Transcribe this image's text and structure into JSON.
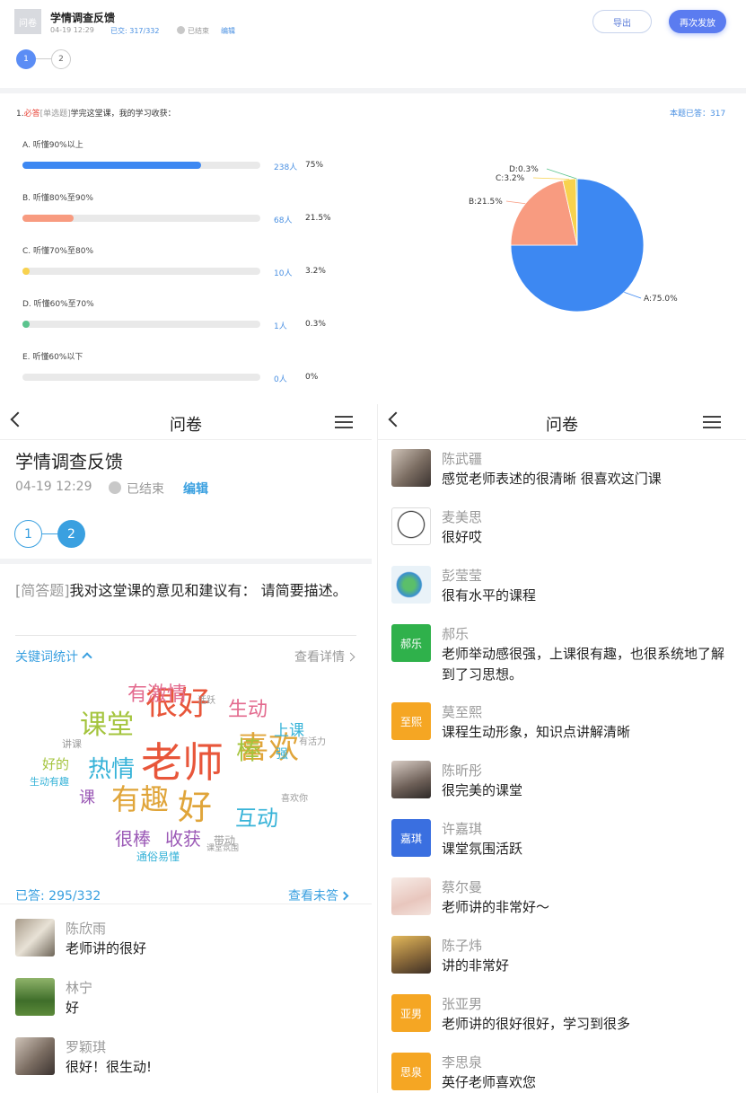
{
  "top": {
    "thumb_text": "问卷",
    "title": "学情调查反馈",
    "date": "04-19 12:29",
    "submitted": "已交: 317/332",
    "status": "已结束",
    "edit": "编辑",
    "export_btn": "导出",
    "resend_btn": "再次发放",
    "pages": [
      "1",
      "2"
    ],
    "question": {
      "num": "1.",
      "required": "必答",
      "type": "[单选题]",
      "text": "学完这堂课，我的学习收获：",
      "answered": "本题已答：317"
    },
    "options": [
      {
        "label": "A. 听懂90%以上",
        "count": "238人",
        "pct": "75%",
        "ratio": 0.75,
        "color": "#3d88f2"
      },
      {
        "label": "B. 听懂80%至90%",
        "count": "68人",
        "pct": "21.5%",
        "ratio": 0.215,
        "color": "#f89b80"
      },
      {
        "label": "C. 听懂70%至80%",
        "count": "10人",
        "pct": "3.2%",
        "ratio": 0.032,
        "color": "#f8d24e"
      },
      {
        "label": "D. 听懂60%至70%",
        "count": "1人",
        "pct": "0.3%",
        "ratio": 0.003,
        "color": "#5bc48e"
      },
      {
        "label": "E. 听懂60%以下",
        "count": "0人",
        "pct": "0%",
        "ratio": 0.0,
        "color": "#cccccc"
      }
    ]
  },
  "chart_data": {
    "type": "pie",
    "categories": [
      "A",
      "B",
      "C",
      "D"
    ],
    "values": [
      75.0,
      21.5,
      3.2,
      0.3
    ],
    "labels": [
      "A:75.0%",
      "B:21.5%",
      "C:3.2%",
      "D:0.3%"
    ],
    "colors": [
      "#3d88f2",
      "#f89b80",
      "#f8d24e",
      "#5bc48e"
    ]
  },
  "left": {
    "header_title": "问卷",
    "title": "学情调查反馈",
    "date": "04-19 12:29",
    "status": "已结束",
    "edit": "编辑",
    "pages": [
      "1",
      "2"
    ],
    "question_type": "[简答题]",
    "question_text": "我对这堂课的意见和建议有： 请简要描述。",
    "keyword_stats": "关键词统计",
    "view_detail": "查看详情",
    "answered": "已答: 295/332",
    "view_unanswered": "查看未答",
    "wordcloud": [
      {
        "w": "老师",
        "c": "#e8563a"
      },
      {
        "w": "很好",
        "c": "#e8563a"
      },
      {
        "w": "喜欢",
        "c": "#e0a53a"
      },
      {
        "w": "有趣",
        "c": "#e0a53a"
      },
      {
        "w": "好",
        "c": "#e0a53a"
      },
      {
        "w": "课堂",
        "c": "#a4c43d"
      },
      {
        "w": "热情",
        "c": "#37b3d8"
      },
      {
        "w": "有激情",
        "c": "#e36a8e"
      },
      {
        "w": "生动",
        "c": "#e36a8e"
      },
      {
        "w": "棒",
        "c": "#a4c43d"
      },
      {
        "w": "互动",
        "c": "#37b3d8"
      },
      {
        "w": "上课",
        "c": "#37b3d8"
      },
      {
        "w": "很棒",
        "c": "#9b59b6"
      },
      {
        "w": "收获",
        "c": "#9b59b6"
      },
      {
        "w": "课",
        "c": "#9b59b6"
      },
      {
        "w": "好的",
        "c": "#a4c43d"
      },
      {
        "w": "强",
        "c": "#37b3d8"
      },
      {
        "w": "带动",
        "c": "#9b9b9b"
      },
      {
        "w": "讲课",
        "c": "#9b9b9b"
      },
      {
        "w": "生动有趣",
        "c": "#37b3d8"
      },
      {
        "w": "通俗易懂",
        "c": "#37b3d8"
      },
      {
        "w": "活跃",
        "c": "#9b9b9b"
      },
      {
        "w": "有活力",
        "c": "#9b9b9b"
      },
      {
        "w": "喜欢你",
        "c": "#9b9b9b"
      },
      {
        "w": "课堂氛围",
        "c": "#9b9b9b"
      }
    ],
    "comments": [
      {
        "name": "陈欣雨",
        "text": "老师讲的很好",
        "avatar": "photo-cat"
      },
      {
        "name": "林宁",
        "text": "好",
        "avatar": "photo-field"
      },
      {
        "name": "罗颖琪",
        "text": "很好！很生动!",
        "avatar": "photo-person"
      }
    ]
  },
  "right": {
    "header_title": "问卷",
    "comments": [
      {
        "name": "陈武疆",
        "text": "感觉老师表述的很清晰  很喜欢这门课",
        "avatar": "photo-person",
        "bg": "#8a7f72"
      },
      {
        "name": "麦美思",
        "text": "很好哎",
        "avatar": "hello-kitty-icon",
        "bg": "#ffffff"
      },
      {
        "name": "彭莹莹",
        "text": "很有水平的课程",
        "avatar": "earth-icon",
        "bg": "#e9f2f8"
      },
      {
        "name": "郝乐",
        "text": "老师举动感很强，上课很有趣，也很系统地了解到了习思想。",
        "avatar": "郝乐",
        "bg": "#2fb14b"
      },
      {
        "name": "莫至熙",
        "text": "课程生动形象，知识点讲解清晰",
        "avatar": "至熙",
        "bg": "#f5a623"
      },
      {
        "name": "陈昕彤",
        "text": "很完美的课堂",
        "avatar": "photo-child",
        "bg": "#b8aba3"
      },
      {
        "name": "许嘉琪",
        "text": "课堂氛围活跃",
        "avatar": "嘉琪",
        "bg": "#3a6fe0"
      },
      {
        "name": "蔡尔曼",
        "text": "老师讲的非常好～",
        "avatar": "photo-baby",
        "bg": "#efdcd4"
      },
      {
        "name": "陈子炜",
        "text": "讲的非常好",
        "avatar": "photo-plush",
        "bg": "#8b6a3a"
      },
      {
        "name": "张亚男",
        "text": "老师讲的很好很好，学习到很多",
        "avatar": "亚男",
        "bg": "#f5a623"
      },
      {
        "name": "李思泉",
        "text": "英仔老师喜欢您",
        "avatar": "思泉",
        "bg": "#f5a623"
      }
    ]
  }
}
